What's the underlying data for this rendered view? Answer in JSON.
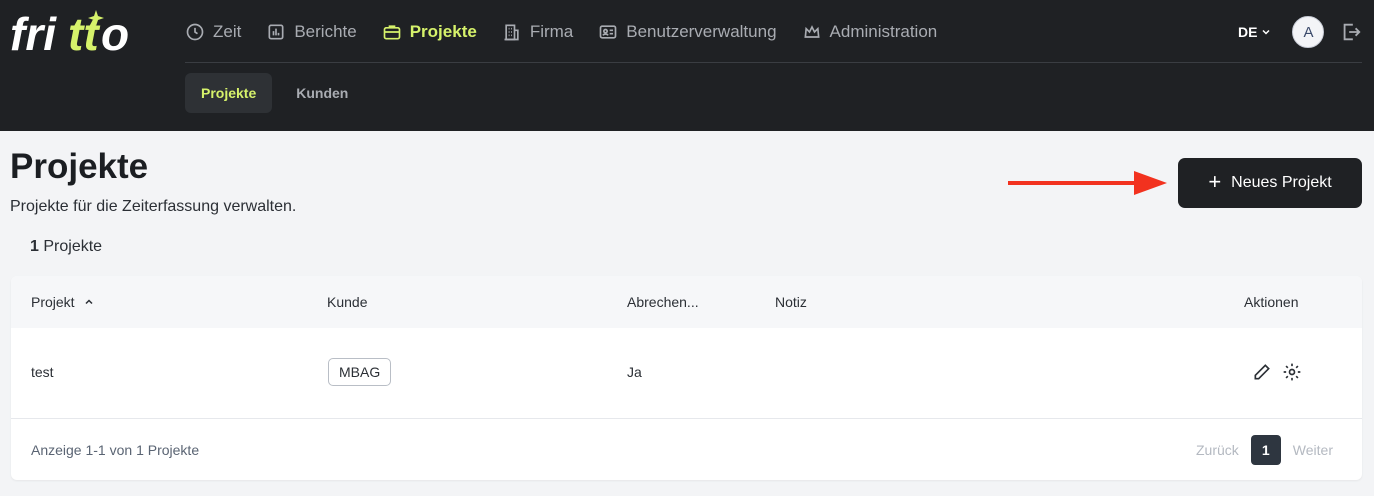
{
  "brand": {
    "logo_text": "fritto",
    "accent": "#d6f26b"
  },
  "nav": {
    "items": [
      {
        "label": "Zeit",
        "icon": "clock-icon"
      },
      {
        "label": "Berichte",
        "icon": "chart-icon"
      },
      {
        "label": "Projekte",
        "icon": "briefcase-icon",
        "active": true
      },
      {
        "label": "Firma",
        "icon": "building-icon"
      },
      {
        "label": "Benutzerverwaltung",
        "icon": "id-card-icon"
      },
      {
        "label": "Administration",
        "icon": "crown-icon"
      }
    ],
    "language": "DE",
    "avatar_initial": "A"
  },
  "subnav": {
    "tabs": [
      {
        "label": "Projekte",
        "active": true
      },
      {
        "label": "Kunden"
      }
    ]
  },
  "page": {
    "title": "Projekte",
    "subtitle": "Projekte für die Zeiterfassung verwalten.",
    "count_number": "1",
    "count_label": "Projekte",
    "new_button": "Neues Projekt"
  },
  "table": {
    "headers": {
      "project": "Projekt",
      "customer": "Kunde",
      "billable": "Abrechen...",
      "note": "Notiz",
      "actions": "Aktionen"
    },
    "rows": [
      {
        "project": "test",
        "customer": "MBAG",
        "billable": "Ja",
        "note": ""
      }
    ],
    "footer": {
      "showing": "Anzeige 1-1 von 1 Projekte",
      "prev": "Zurück",
      "page": "1",
      "next": "Weiter"
    }
  }
}
